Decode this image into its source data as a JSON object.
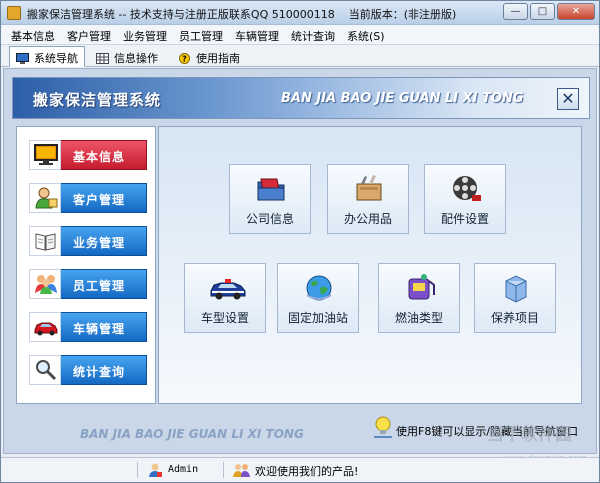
{
  "window": {
    "title": "搬家保洁管理系统 -- 技术支持与注册正版联系QQ 510000118",
    "version": "当前版本：(非注册版)",
    "minimize": "—",
    "maximize": "□",
    "close": "✕"
  },
  "menu": [
    "基本信息",
    "客户管理",
    "业务管理",
    "员工管理",
    "车辆管理",
    "统计查询",
    "系统(S)"
  ],
  "tabs": [
    {
      "label": "系统导航",
      "icon": "monitor-icon",
      "active": true
    },
    {
      "label": "信息操作",
      "icon": "grid-icon",
      "active": false
    },
    {
      "label": "使用指南",
      "icon": "help-icon",
      "active": false
    }
  ],
  "banner": {
    "title": "搬家保洁管理系统",
    "subtitle": "BAN JIA BAO JIE GUAN LI XI TONG",
    "close": "✕"
  },
  "nav": [
    {
      "label": "基本信息",
      "icon": "monitor-icon",
      "active": true
    },
    {
      "label": "客户管理",
      "icon": "customer-icon",
      "active": false
    },
    {
      "label": "业务管理",
      "icon": "book-icon",
      "active": false
    },
    {
      "label": "员工管理",
      "icon": "people-icon",
      "active": false
    },
    {
      "label": "车辆管理",
      "icon": "car-icon",
      "active": false
    },
    {
      "label": "统计查询",
      "icon": "magnifier-icon",
      "active": false
    }
  ],
  "functions": [
    {
      "label": "公司信息",
      "icon": "folder-icon"
    },
    {
      "label": "办公用品",
      "icon": "office-supplies-icon"
    },
    {
      "label": "配件设置",
      "icon": "film-reel-icon"
    },
    {
      "label": "车型设置",
      "icon": "police-car-icon"
    },
    {
      "label": "固定加油站",
      "icon": "globe-icon"
    },
    {
      "label": "燃油类型",
      "icon": "fuel-icon"
    },
    {
      "label": "保养项目",
      "icon": "box-icon"
    }
  ],
  "footer": {
    "subtitle": "BAN JIA BAO JIE GUAN LI XI TONG",
    "hint": "使用F8键可以显示/隐藏当前导航窗口"
  },
  "status": {
    "user": "Admin",
    "message": "欢迎使用我们的产品!"
  },
  "watermark": {
    "text": "当下软件园",
    "url": "www.downxia.com"
  },
  "colors": {
    "nav_active": "#d62a3c",
    "nav_default": "#1e78d2",
    "banner": "#2d5fa8"
  }
}
